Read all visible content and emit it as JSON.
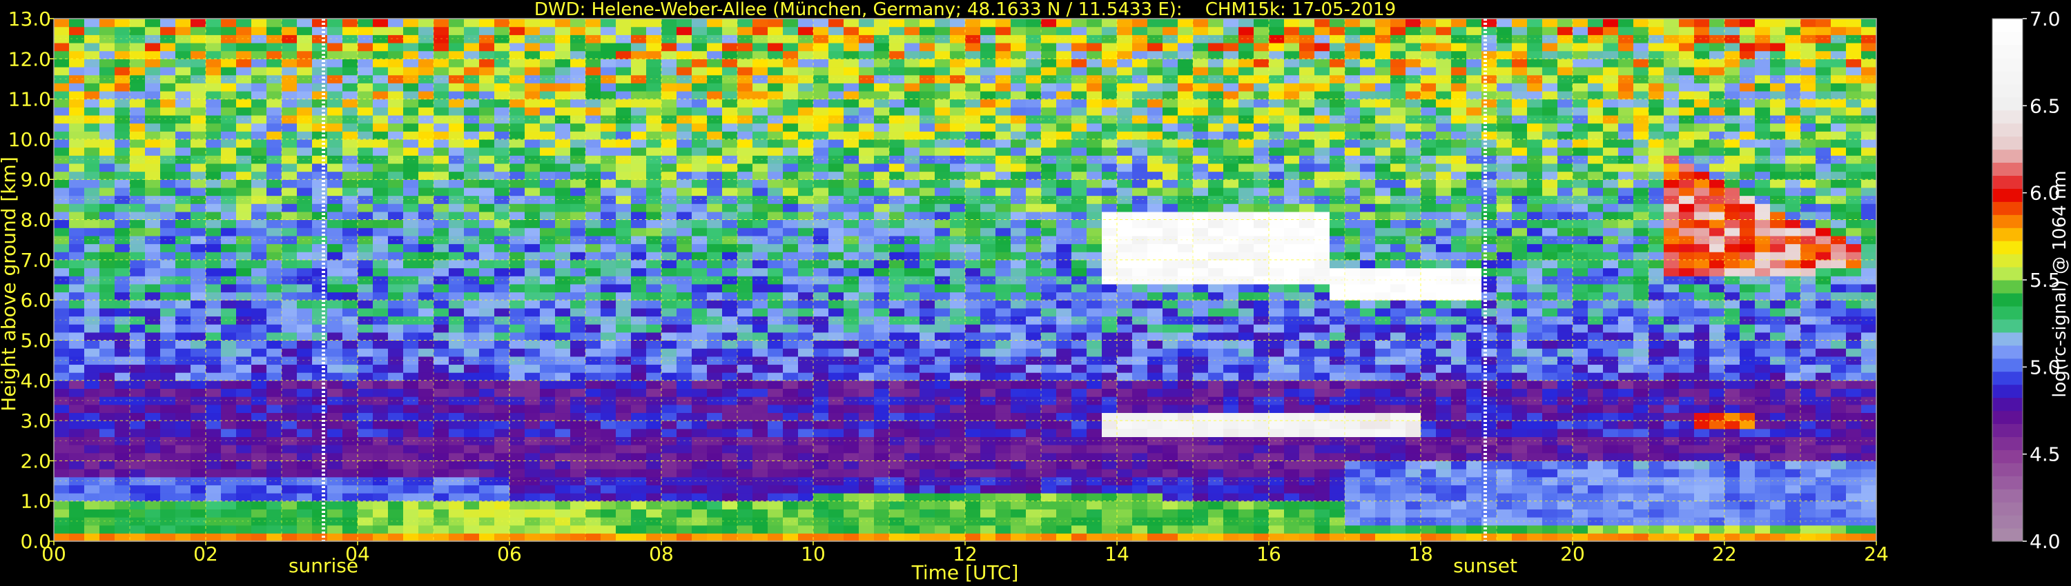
{
  "chart_data": {
    "type": "heatmap",
    "title": "DWD: Helene-Weber-Allee (München, Germany; 48.1633 N / 11.5433 E):    CHM15k: 17-05-2019",
    "xlabel": "Time [UTC]",
    "ylabel": "Height above ground [km]",
    "xlim": [
      0,
      24
    ],
    "ylim": [
      0,
      13
    ],
    "xticks": [
      "00",
      "02",
      "04",
      "06",
      "08",
      "10",
      "12",
      "14",
      "16",
      "18",
      "20",
      "22",
      "24"
    ],
    "yticks": [
      "0.0",
      "1.0",
      "2.0",
      "3.0",
      "4.0",
      "5.0",
      "6.0",
      "7.0",
      "8.0",
      "9.0",
      "10.0",
      "11.0",
      "12.0",
      "13.0"
    ],
    "grid": true,
    "markers": [
      {
        "label": "sunrise",
        "time": 3.55
      },
      {
        "label": "sunset",
        "time": 18.85
      }
    ],
    "colorbar": {
      "label": "log(rc-signal) @ 1064 nm",
      "range": [
        4.0,
        7.0
      ],
      "ticks": [
        "4.0",
        "4.5",
        "5.0",
        "5.5",
        "6.0",
        "6.5",
        "7.0"
      ]
    },
    "features": [
      {
        "name": "surface aerosol layer",
        "t_start": 0,
        "t_end": 24,
        "h_bottom": 0.0,
        "h_top": 1.0,
        "log_signal": 5.4
      },
      {
        "name": "residual layer",
        "t_start": 0,
        "t_end": 5,
        "h_bottom": 1.0,
        "h_top": 1.6,
        "log_signal": 4.9
      },
      {
        "name": "convective boundary layer",
        "t_start": 8,
        "t_end": 17,
        "h_bottom": 0.0,
        "h_top": 1.2,
        "log_signal": 5.5
      },
      {
        "name": "mid-level cloud",
        "t_start": 13.8,
        "t_end": 18,
        "h_bottom": 2.6,
        "h_top": 3.3,
        "log_signal": 6.8
      },
      {
        "name": "mid-level cloud",
        "t_start": 21.5,
        "t_end": 22.5,
        "h_bottom": 2.9,
        "h_top": 3.3,
        "log_signal": 6.0
      },
      {
        "name": "high cloud",
        "t_start": 13.8,
        "t_end": 18.8,
        "h_bottom": 5.9,
        "h_top": 8.3,
        "log_signal": 7.0
      },
      {
        "name": "high cloud",
        "t_start": 21.2,
        "t_end": 23.8,
        "h_bottom": 6.5,
        "h_top": 9.8,
        "log_signal": 6.2
      }
    ]
  }
}
